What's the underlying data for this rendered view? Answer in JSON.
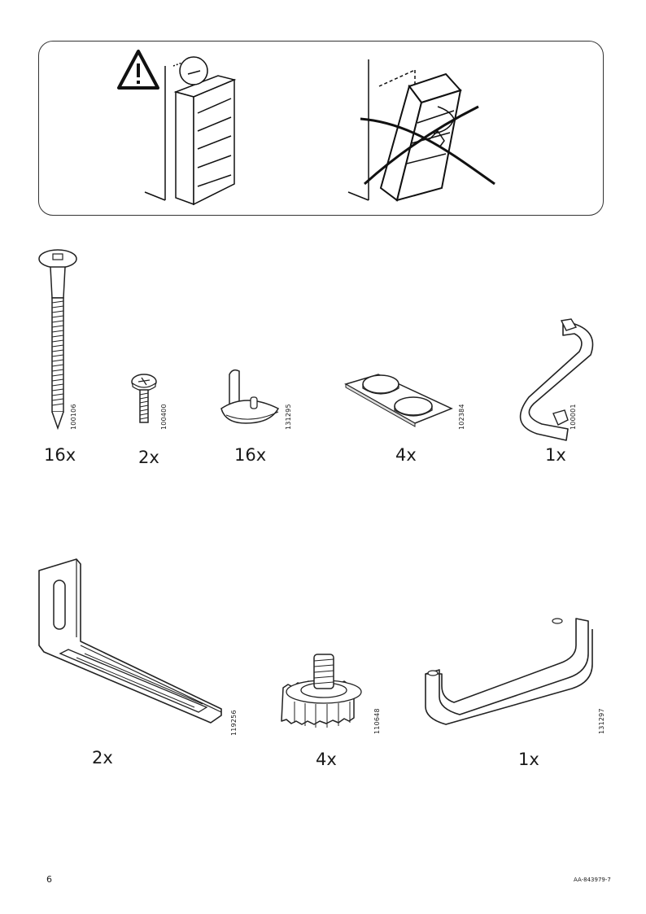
{
  "warning": {
    "icon": "warning-triangle-icon"
  },
  "parts_row1": [
    {
      "code": "100106",
      "qty": "16x",
      "icon": "long-screw-icon"
    },
    {
      "code": "100400",
      "qty": "2x",
      "icon": "short-screw-icon"
    },
    {
      "code": "131295",
      "qty": "16x",
      "icon": "shelf-support-pin-icon"
    },
    {
      "code": "102384",
      "qty": "4x",
      "icon": "adhesive-bumper-pads-icon"
    },
    {
      "code": "100001",
      "qty": "1x",
      "icon": "allen-key-icon"
    }
  ],
  "parts_row2": [
    {
      "code": "119256",
      "qty": "2x",
      "icon": "angle-bracket-icon"
    },
    {
      "code": "110648",
      "qty": "4x",
      "icon": "adjustable-foot-icon"
    },
    {
      "code": "131297",
      "qty": "1x",
      "icon": "u-handle-icon"
    }
  ],
  "footer": {
    "page_number": "6",
    "document_id": "AA-843979-7"
  }
}
